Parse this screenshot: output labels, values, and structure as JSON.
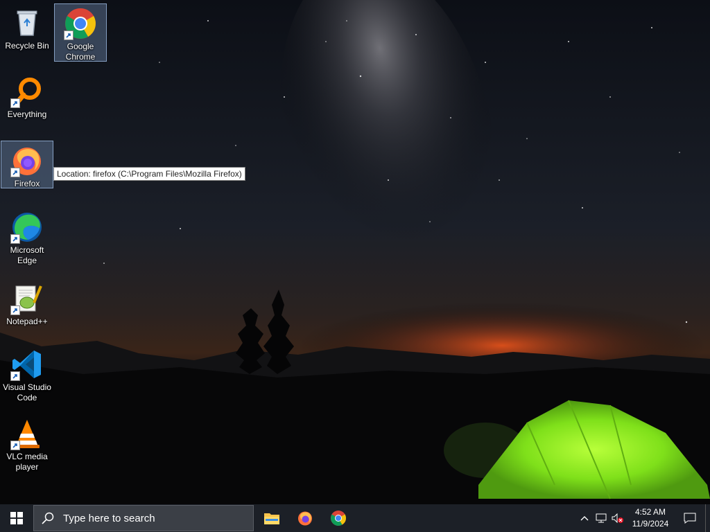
{
  "desktop": {
    "icons": [
      {
        "label": "Recycle Bin",
        "icon": "recycle-bin-icon",
        "shortcut": false
      },
      {
        "label": "Google Chrome",
        "icon": "chrome-icon",
        "shortcut": true,
        "selected": true
      },
      {
        "label": "Everything",
        "icon": "everything-icon",
        "shortcut": true
      },
      {
        "label": "Firefox",
        "icon": "firefox-icon",
        "shortcut": true,
        "selected": true
      },
      {
        "label": "Microsoft Edge",
        "icon": "edge-icon",
        "shortcut": true
      },
      {
        "label": "Notepad++",
        "icon": "notepadpp-icon",
        "shortcut": true
      },
      {
        "label": "Visual Studio Code",
        "icon": "vscode-icon",
        "shortcut": true
      },
      {
        "label": "VLC media player",
        "icon": "vlc-icon",
        "shortcut": true
      }
    ],
    "tooltip": "Location: firefox (C:\\Program Files\\Mozilla Firefox)"
  },
  "taskbar": {
    "search_placeholder": "Type here to search",
    "pinned": [
      "file-explorer-icon",
      "firefox-icon",
      "chrome-icon"
    ],
    "tray": {
      "time": "4:52 AM",
      "date": "11/9/2024",
      "icons": [
        "chevron-up-icon",
        "network-icon",
        "volume-muted-icon",
        "notification-icon"
      ]
    }
  },
  "colors": {
    "taskbar": "#1c2027",
    "search_box": "#3b3f46",
    "tent_green": "#7fe01a",
    "horizon_glow": "#e0501a"
  }
}
